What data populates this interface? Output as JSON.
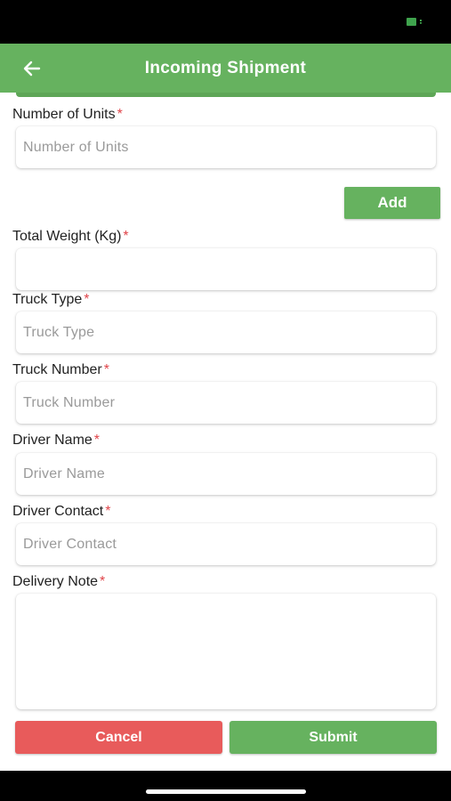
{
  "header": {
    "title": "Incoming Shipment",
    "back_icon": "arrow-left-icon"
  },
  "form": {
    "units": {
      "label": "Number of Units",
      "required": "*",
      "placeholder": "Number of Units",
      "value": ""
    },
    "add_label": "Add",
    "weight": {
      "label": "Total Weight (Kg)",
      "required": "*",
      "placeholder": "",
      "value": ""
    },
    "truck_type": {
      "label": "Truck Type",
      "required": "*",
      "placeholder": "Truck Type",
      "value": ""
    },
    "truck_number": {
      "label": "Truck Number",
      "required": "*",
      "placeholder": "Truck Number",
      "value": ""
    },
    "driver_name": {
      "label": "Driver Name",
      "required": "*",
      "placeholder": "Driver Name",
      "value": ""
    },
    "driver_contact": {
      "label": "Driver Contact",
      "required": "*",
      "placeholder": "Driver Contact",
      "value": ""
    },
    "delivery_note": {
      "label": "Delivery Note",
      "required": "*",
      "value": ""
    }
  },
  "actions": {
    "cancel_label": "Cancel",
    "submit_label": "Submit"
  },
  "colors": {
    "primary": "#66b25f",
    "danger": "#e85b5b",
    "required": "#e0454a"
  }
}
